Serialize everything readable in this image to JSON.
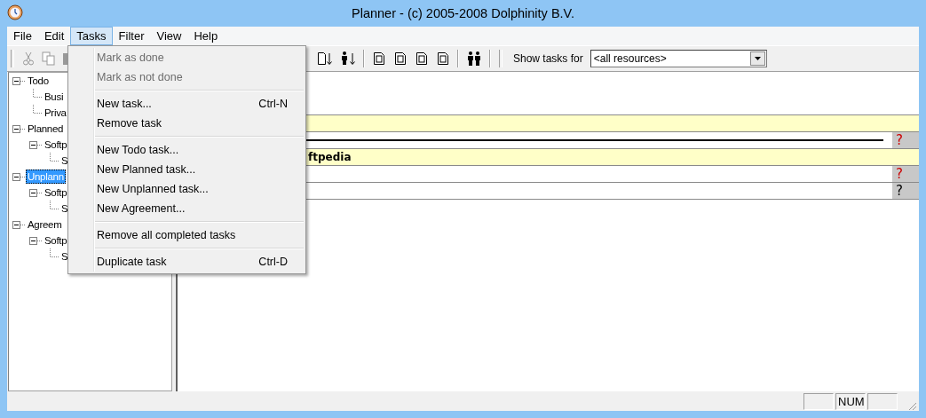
{
  "window": {
    "title": "Planner - (c) 2005-2008 Dolphinity B.V."
  },
  "menu_bar": [
    {
      "label": "File",
      "selected": false
    },
    {
      "label": "Edit",
      "selected": false
    },
    {
      "label": "Tasks",
      "selected": true
    },
    {
      "label": "Filter",
      "selected": false
    },
    {
      "label": "View",
      "selected": false
    },
    {
      "label": "Help",
      "selected": false
    }
  ],
  "toolbar": {
    "filter_label": "Show tasks for",
    "resource_dropdown": {
      "value": "<all resources>"
    }
  },
  "tree": [
    {
      "label": "Todo",
      "expanded": true,
      "selected": false,
      "children": [
        {
          "label": "Busi",
          "selected": false
        },
        {
          "label": "Priva",
          "selected": false
        }
      ]
    },
    {
      "label": "Planned",
      "expanded": true,
      "selected": false,
      "children": [
        {
          "label": "Softp",
          "expanded": true,
          "selected": false,
          "children": [
            {
              "label": "S",
              "selected": false
            }
          ]
        }
      ]
    },
    {
      "label": "Unplann",
      "expanded": true,
      "selected": true,
      "children": [
        {
          "label": "Softp",
          "expanded": true,
          "selected": false,
          "children": [
            {
              "label": "S",
              "selected": false
            }
          ]
        }
      ]
    },
    {
      "label": "Agreem",
      "expanded": true,
      "selected": false,
      "children": [
        {
          "label": "Softp",
          "expanded": true,
          "selected": false,
          "children": [
            {
              "label": "S",
              "selected": false
            }
          ]
        }
      ]
    }
  ],
  "task_rows": [
    {
      "kind": "header"
    },
    {
      "kind": "task",
      "bar": true,
      "status": "?",
      "color": "#cc0000"
    },
    {
      "kind": "header",
      "text": "ftpedia"
    },
    {
      "kind": "task",
      "bar": false,
      "status": "?",
      "color": "#cc0000"
    },
    {
      "kind": "task",
      "bar": false,
      "status": "?",
      "color": "#000000"
    }
  ],
  "tasks_menu": [
    {
      "kind": "item",
      "label": "Mark as done",
      "disabled": true
    },
    {
      "kind": "item",
      "label": "Mark as not done",
      "disabled": true
    },
    {
      "kind": "separator"
    },
    {
      "kind": "item",
      "label": "New task...",
      "shortcut": "Ctrl-N",
      "disabled": false
    },
    {
      "kind": "item",
      "label": "Remove task",
      "disabled": false
    },
    {
      "kind": "separator"
    },
    {
      "kind": "item",
      "label": "New Todo task...",
      "disabled": false
    },
    {
      "kind": "item",
      "label": "New Planned task...",
      "disabled": false
    },
    {
      "kind": "item",
      "label": "New Unplanned task...",
      "disabled": false
    },
    {
      "kind": "item",
      "label": "New Agreement...",
      "disabled": false
    },
    {
      "kind": "separator"
    },
    {
      "kind": "item",
      "label": "Remove all completed tasks",
      "disabled": false
    },
    {
      "kind": "separator"
    },
    {
      "kind": "item",
      "label": "Duplicate task",
      "shortcut": "Ctrl-D",
      "disabled": false
    }
  ],
  "status_bar": {
    "num": "NUM"
  }
}
